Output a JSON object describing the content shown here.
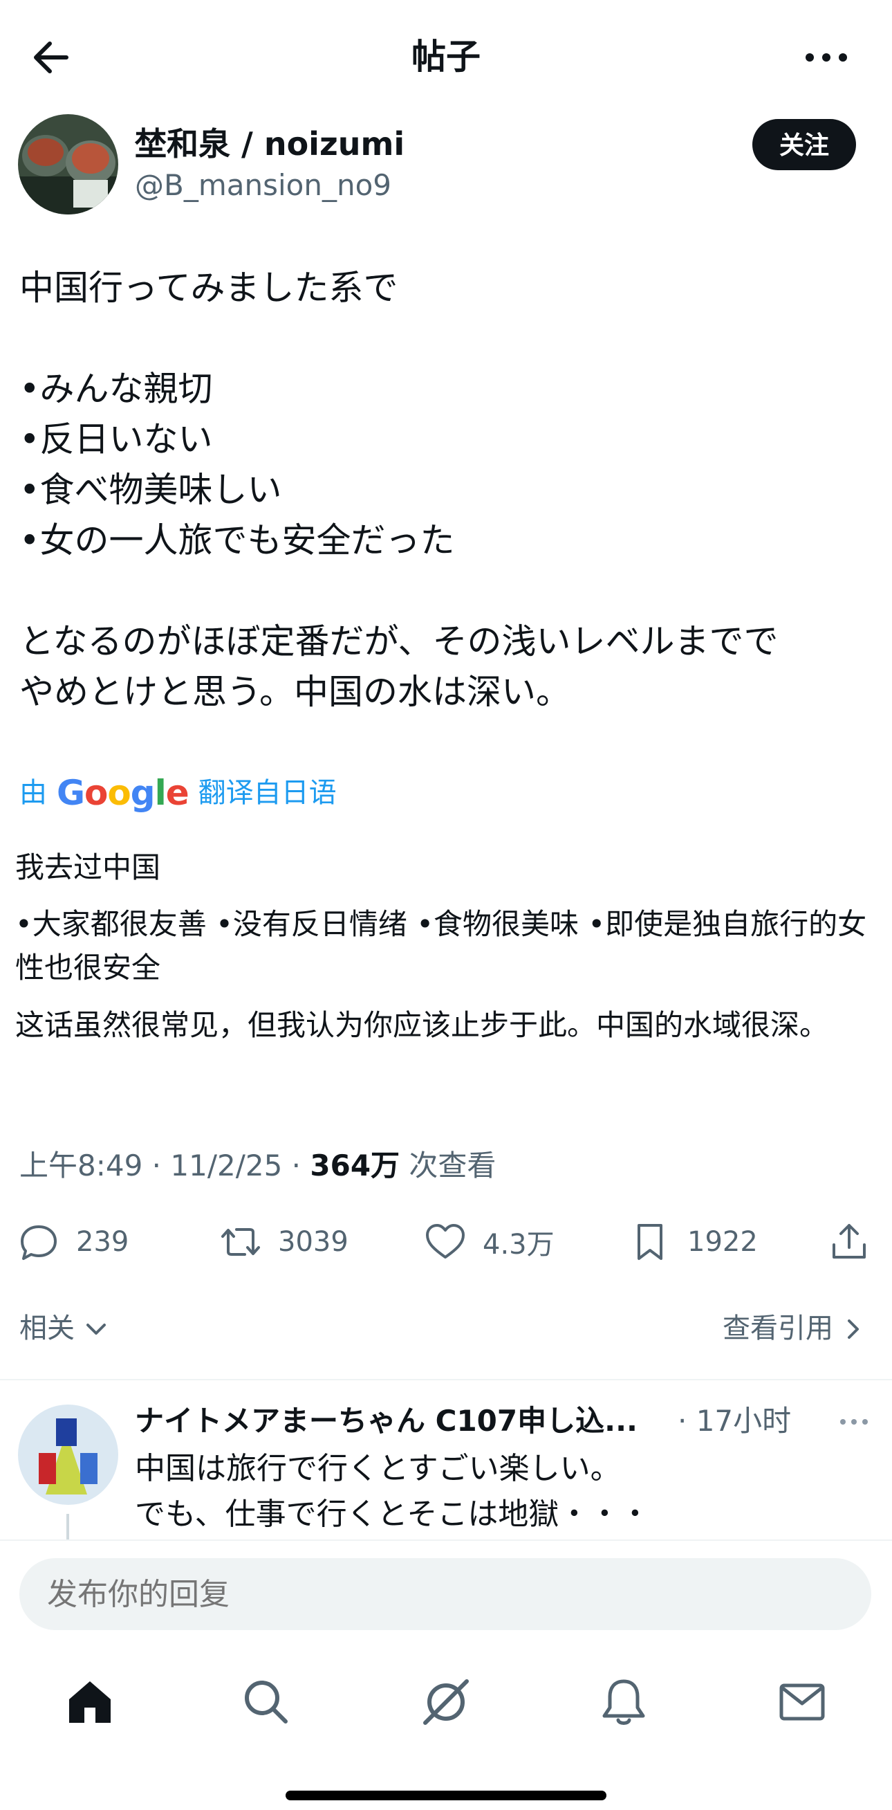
{
  "header": {
    "title": "帖子"
  },
  "author": {
    "name": "埜和泉 / noizumi",
    "handle": "@B_mansion_no9",
    "follow_label": "关注"
  },
  "tweet": {
    "text": "中国行ってみました系で\n\n•みんな親切\n•反日いない\n•食べ物美味しい\n•女の一人旅でも安全だった\n\nとなるのがほぼ定番だが、その浅いレベルまでで\nやめとけと思う。中国の水は深い。"
  },
  "translation": {
    "prefix": "由",
    "logo": "Google",
    "suffix": "翻译自日语",
    "paragraphs": [
      "我去过中国",
      "•大家都很友善 •没有反日情绪 •食物很美味 •即使是独自旅行的女性也很安全",
      "这话虽然很常见，但我认为你应该止步于此。中国的水域很深。"
    ]
  },
  "meta": {
    "time": "上午8:49",
    "sep1": " · ",
    "date": "11/2/25",
    "sep2": " · ",
    "views": "364万",
    "views_label": " 次查看"
  },
  "actions": {
    "replies": "239",
    "reposts": "3039",
    "likes": "4.3万",
    "bookmarks": "1922"
  },
  "links": {
    "related": "相关",
    "view_quotes": "查看引用"
  },
  "reply": {
    "name": "ナイトメアまーちゃん C107申し込...",
    "time": "· 17小时",
    "text": "中国は旅行で行くとすごい楽しい。\nでも、仕事で行くとそこは地獄・・・"
  },
  "composer": {
    "placeholder": "发布你的回复"
  },
  "icons": [
    "back-arrow-icon",
    "more-icon",
    "reply-icon",
    "repost-icon",
    "like-icon",
    "bookmark-icon",
    "share-icon",
    "chevron-down-icon",
    "chevron-right-icon",
    "home-icon",
    "search-icon",
    "grok-icon",
    "bell-icon",
    "mail-icon"
  ],
  "colors": {
    "link_blue": "#1d9bf0",
    "muted": "#536471",
    "text": "#0f1419",
    "google_blue": "#4285F4",
    "google_red": "#EA4335",
    "google_yellow": "#FBBC05",
    "google_green": "#34A853"
  }
}
